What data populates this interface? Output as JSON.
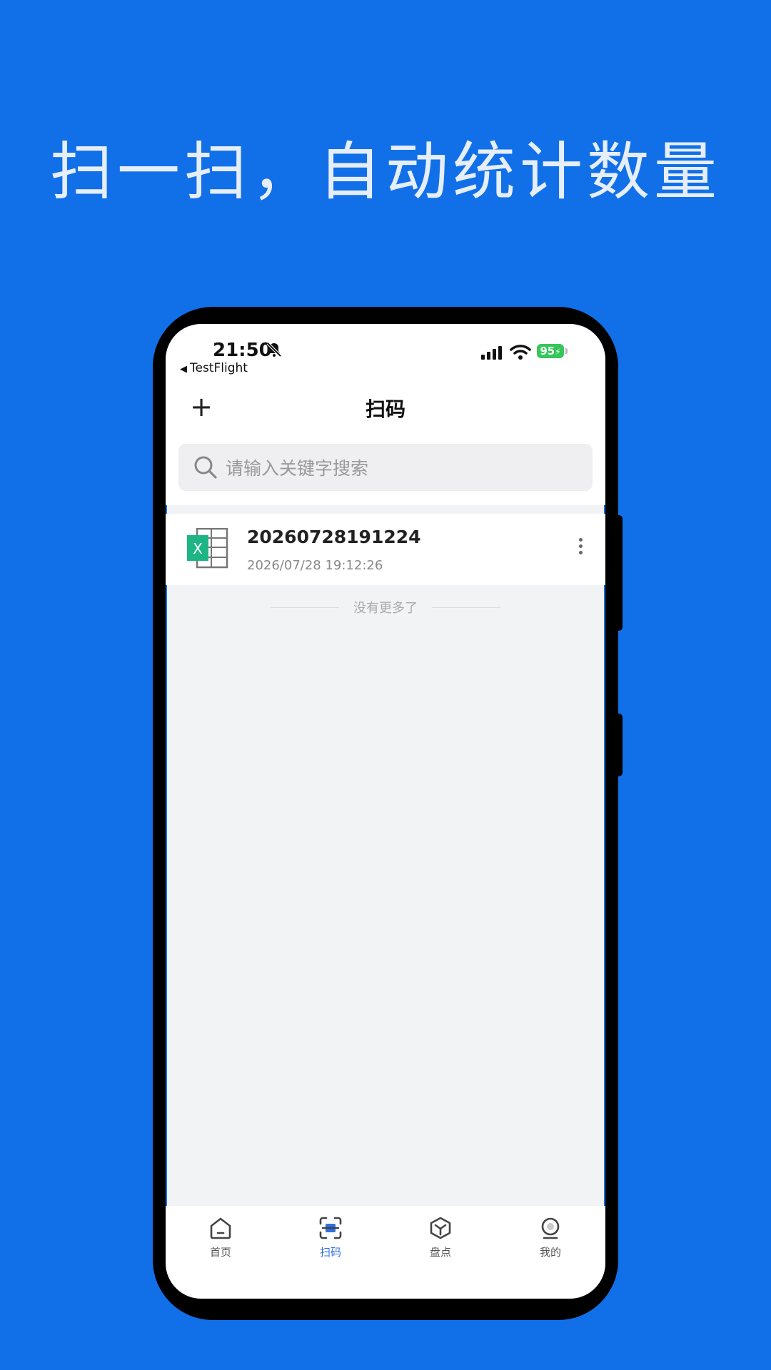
{
  "headline": "扫一扫，自动统计数量",
  "status_bar": {
    "time": "21:50",
    "back_app": "TestFlight",
    "battery": "95"
  },
  "navbar": {
    "add_label": "+",
    "title": "扫码"
  },
  "search": {
    "placeholder": "请输入关键字搜索"
  },
  "list": {
    "items": [
      {
        "title": "20260728191224",
        "time": "2026/07/28 19:12:26",
        "icon": "excel-file-icon"
      }
    ],
    "no_more_text": "没有更多了"
  },
  "tabbar": {
    "items": [
      {
        "label": "首页",
        "icon": "home-icon",
        "active": false
      },
      {
        "label": "扫码",
        "icon": "scan-icon",
        "active": true
      },
      {
        "label": "盘点",
        "icon": "box-icon",
        "active": false
      },
      {
        "label": "我的",
        "icon": "profile-icon",
        "active": false
      }
    ]
  },
  "colors": {
    "background": "#1170E8",
    "accent": "#2F6FE0",
    "excel_green": "#1DB584",
    "battery_green": "#34C759"
  }
}
